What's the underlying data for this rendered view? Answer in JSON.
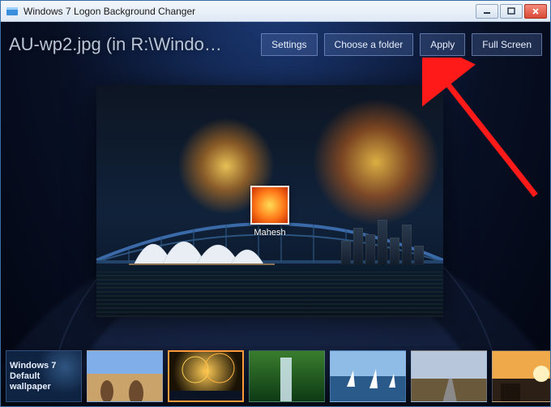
{
  "window": {
    "title": "Windows 7 Logon Background Changer"
  },
  "header": {
    "file_label": "AU-wp2.jpg (in R:\\Windo…",
    "buttons": {
      "settings": "Settings",
      "choose_folder": "Choose a folder",
      "apply": "Apply",
      "fullscreen": "Full Screen"
    }
  },
  "preview": {
    "user_name": "Mahesh"
  },
  "thumbnails": {
    "default_label": "Windows 7 Default wallpaper",
    "items": [
      {
        "id": "default",
        "selected": false
      },
      {
        "id": "desert",
        "selected": false
      },
      {
        "id": "fireworks",
        "selected": true
      },
      {
        "id": "waterfall",
        "selected": false
      },
      {
        "id": "boats",
        "selected": false
      },
      {
        "id": "road",
        "selected": false
      },
      {
        "id": "sunset",
        "selected": false
      }
    ]
  },
  "annotation": {
    "arrow_target": "apply-button",
    "arrow_color": "#ff1a1a"
  }
}
